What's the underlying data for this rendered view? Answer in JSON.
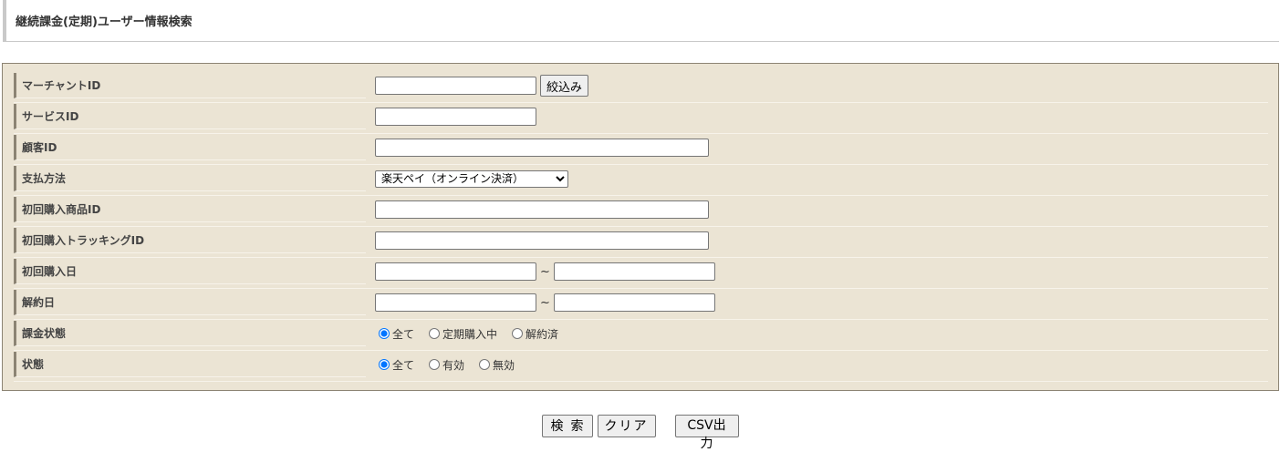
{
  "header": {
    "title": "継続課金(定期)ユーザー情報検索"
  },
  "form": {
    "merchant_id": {
      "label": "マーチャントID",
      "value": "",
      "filter_button": "絞込み"
    },
    "service_id": {
      "label": "サービスID",
      "value": ""
    },
    "customer_id": {
      "label": "顧客ID",
      "value": ""
    },
    "payment_method": {
      "label": "支払方法",
      "selected": "楽天ペイ（オンライン決済）"
    },
    "first_product_id": {
      "label": "初回購入商品ID",
      "value": ""
    },
    "first_tracking_id": {
      "label": "初回購入トラッキングID",
      "value": ""
    },
    "first_purchase_date": {
      "label": "初回購入日",
      "from": "",
      "to": "",
      "separator": "~"
    },
    "cancel_date": {
      "label": "解約日",
      "from": "",
      "to": "",
      "separator": "~"
    },
    "billing_status": {
      "label": "課金状態",
      "options": [
        "全て",
        "定期購入中",
        "解約済"
      ],
      "selected_index": 0
    },
    "status": {
      "label": "状態",
      "options": [
        "全て",
        "有効",
        "無効"
      ],
      "selected_index": 0
    }
  },
  "footer": {
    "search_label": "検索",
    "clear_label": "クリア",
    "csv_label": "CSV出力"
  }
}
